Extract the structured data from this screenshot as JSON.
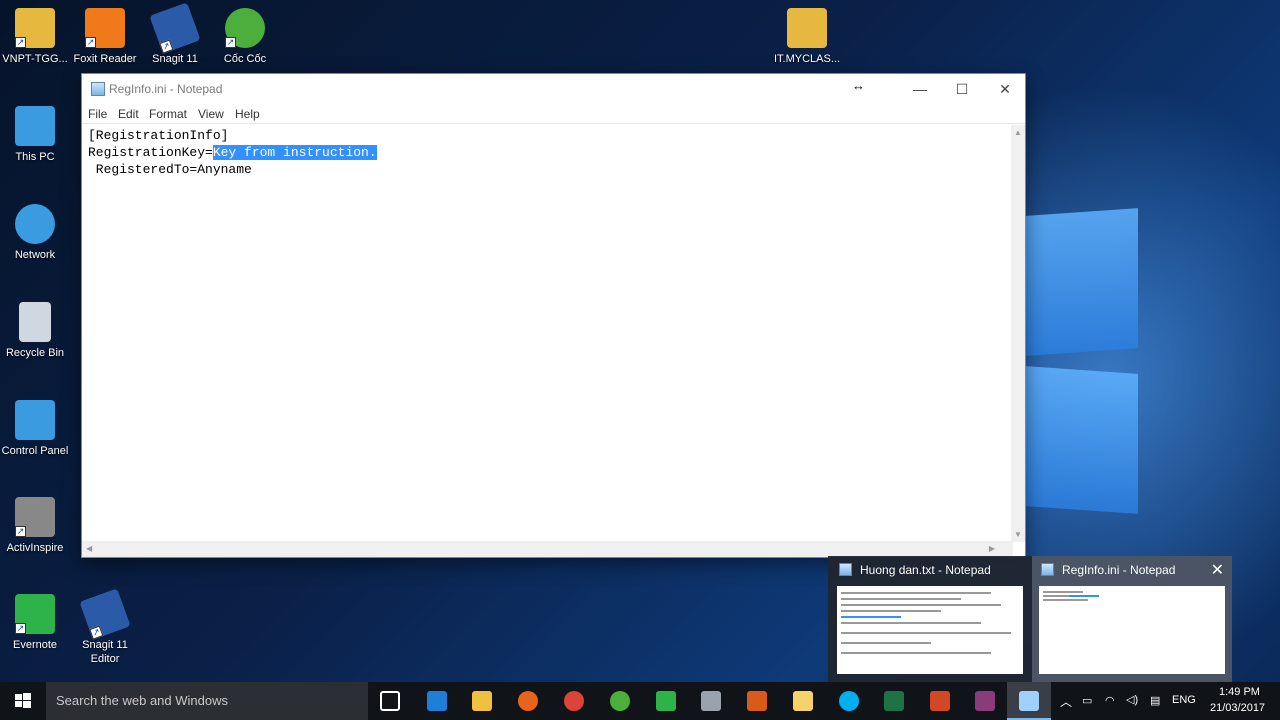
{
  "desktop": {
    "icons": [
      {
        "label": "VNPT-TGG...",
        "color": "#e6b840"
      },
      {
        "label": "Foxit Reader",
        "color": "#f07a1a"
      },
      {
        "label": "Snagit 11",
        "color": "#2a5aa8"
      },
      {
        "label": "Cốc Cốc",
        "color": "#4caf3c"
      },
      {
        "label": "IT.MYCLAS...",
        "color": "#e6b840"
      },
      {
        "label": "This PC",
        "color": "#3a9be0"
      },
      {
        "label": "Network",
        "color": "#3a9be0"
      },
      {
        "label": "Recycle Bin",
        "color": "#cfd8e0"
      },
      {
        "label": "Control Panel",
        "color": "#3a9be0"
      },
      {
        "label": "ActivInspire",
        "color": "#888888"
      },
      {
        "label": "Evernote",
        "color": "#2db34a"
      },
      {
        "label": "Snagit 11 Editor",
        "color": "#2a5aa8"
      }
    ]
  },
  "notepad": {
    "title": "RegInfo.ini - Notepad",
    "menu": [
      "File",
      "Edit",
      "Format",
      "View",
      "Help"
    ],
    "lines": {
      "l1": "[RegistrationInfo]",
      "l2_prefix": "RegistrationKey=",
      "l2_selected": "Key from instruction.",
      "l3": " RegisteredTo=Anyname"
    },
    "controls": {
      "minimize": "—",
      "maximize": "☐",
      "close": "✕"
    }
  },
  "taskbar": {
    "search_placeholder": "Search the web and Windows",
    "lang": "ENG",
    "time": "1:49 PM",
    "date": "21/03/2017",
    "accent": "#76b9ed"
  },
  "previews": [
    {
      "title": "Huong dan.txt - Notepad"
    },
    {
      "title": "RegInfo.ini - Notepad",
      "close": "✕"
    }
  ]
}
